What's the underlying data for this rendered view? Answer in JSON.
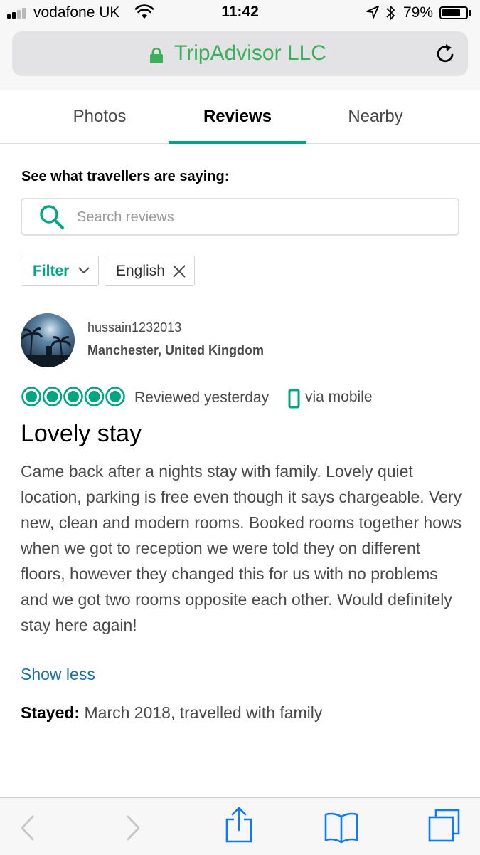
{
  "status_bar": {
    "carrier": "vodafone UK",
    "time": "11:42",
    "battery_percent": "79%",
    "battery_level": 0.79
  },
  "browser": {
    "url_title": "TripAdvisor LLC",
    "secure": true
  },
  "tabs": [
    {
      "label": "Photos",
      "active": false
    },
    {
      "label": "Reviews",
      "active": true
    },
    {
      "label": "Nearby",
      "active": false
    }
  ],
  "reviews_section": {
    "heading": "See what travellers are saying:",
    "search_placeholder": "Search reviews",
    "search_value": "",
    "filter_label": "Filter",
    "language_chip": "English"
  },
  "review": {
    "username": "hussain1232013",
    "location": "Manchester, United Kingdom",
    "rating": 5,
    "rating_max": 5,
    "reviewed": "Reviewed yesterday",
    "via": "via mobile",
    "title": "Lovely stay",
    "body": "Came back after a nights stay with family. Lovely quiet location, parking is free even though it says chargeable. Very new, clean and modern rooms. Booked rooms together hows when we got to reception we were told they on different floors, however they changed this for us with no problems and we got two rooms opposite each other. Would definitely stay here again!",
    "show_less": "Show less",
    "stayed_label": "Stayed:",
    "stayed_value": " March 2018, travelled with family"
  },
  "colors": {
    "brand_green": "#00a680",
    "url_green": "#3cae5c",
    "link_blue": "#1f6fa3",
    "toolbar_blue": "#0a7aff"
  },
  "toolbar": {
    "icons": [
      "back-icon",
      "forward-icon",
      "share-icon",
      "bookmarks-icon",
      "tabs-icon"
    ]
  }
}
